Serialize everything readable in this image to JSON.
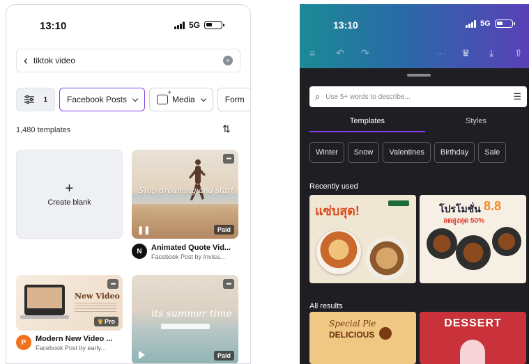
{
  "left": {
    "status": {
      "time": "13:10",
      "network": "5G"
    },
    "search": {
      "value": "tiktok video"
    },
    "filter_count": "1",
    "chips": [
      "Facebook Posts",
      "Media",
      "Form"
    ],
    "template_count": "1,480 templates",
    "create_blank": "Create blank",
    "cards": [
      {
        "title": "Animated Quote Vid...",
        "subtitle": "Facebook Post by Invisu...",
        "avatar": "N",
        "badge": "Paid",
        "quote": "Stop dreaming and start"
      },
      {
        "title": "Modern New Video ...",
        "subtitle": "Facebook Post by early...",
        "avatar": "P",
        "badge": "Pro",
        "image_text": "New Video"
      },
      {
        "badge": "Paid",
        "image_text": "its summer time"
      }
    ]
  },
  "right": {
    "status": {
      "time": "13:10",
      "network": "5G"
    },
    "search": {
      "placeholder": "Use 5+ words to describe..."
    },
    "tabs": [
      "Templates",
      "Styles"
    ],
    "chips": [
      "Winter",
      "Snow",
      "Valentines",
      "Birthday",
      "Sale"
    ],
    "sections": {
      "recent": "Recently used",
      "all": "All results"
    },
    "recent_items": [
      {
        "headline": "แซ่บสุด!"
      },
      {
        "headline": "โปรโมชั่น",
        "highlight": "8.8",
        "discount": "ลดสูงสุด 50%"
      }
    ],
    "results": [
      {
        "line1": "Special Pie",
        "line2": "DELICIOUS"
      },
      {
        "line1": "DESSERT"
      }
    ]
  },
  "colors": {
    "accent": "#8b3dff",
    "chip_active": "#7b3fe4",
    "header_start": "#1b8a96",
    "header_end": "#5a40b8"
  },
  "icons": [
    "back-arrow-icon",
    "clear-icon",
    "filter-icon",
    "media-icon",
    "sort-icon",
    "more-icon",
    "crown-icon",
    "pause-icon",
    "play-icon",
    "menu-icon",
    "undo-icon",
    "redo-icon",
    "download-icon",
    "share-icon",
    "magic-search-icon",
    "sliders-icon"
  ]
}
